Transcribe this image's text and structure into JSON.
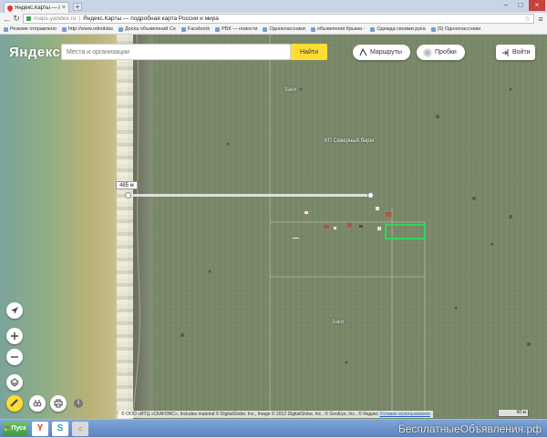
{
  "browser": {
    "tab_title": "Яндекс.Карты — подо",
    "tab_close": "×",
    "new_tab": "+",
    "window_controls": {
      "minimize": "–",
      "maximize": "□",
      "close": "×"
    },
    "address": {
      "host": "maps.yandex.ru",
      "separator": "|",
      "page_title": "Яндекс.Карты — подробная карта России и мира"
    },
    "bookmarks": [
      "Резюме отправлено",
      "http://www.odnoklas",
      "Доска объявлений Се",
      "Facebook",
      "РБК — новости",
      "Одноклассники",
      "объявления Крыма -",
      "Одежда своими рука",
      "(5) Одноклассники"
    ]
  },
  "map": {
    "logo": "Яндекс",
    "search_placeholder": "Места и организации",
    "search_button": "Найти",
    "routes_button": "Маршруты",
    "traffic_button": "Пробки",
    "login_button": "Войти",
    "measure_label": "485 м",
    "place_labels": {
      "main": "КП Северный берег",
      "north": "Заки",
      "south": "Заки"
    },
    "copyright": "© ООО «ИТЦ «СКАНЭКС», Includes material © DigitalGlobe, Inc., Image © 2012 DigitalGlobe, Inc., © GeoEye, Inc., © Яндекс",
    "terms_link": "Условия использования",
    "scale_label": "60 м",
    "info_label": "i"
  },
  "taskbar": {
    "start_label": "Пуск",
    "yandex_icon": "Y",
    "skype_icon": "S",
    "other_icon": "⌂"
  },
  "watermark": "БесплатныеОбъявления.рф",
  "colors": {
    "yandex_red": "#e8312a",
    "search_button": "#fddc34",
    "parcel_outline": "#32d45a"
  }
}
